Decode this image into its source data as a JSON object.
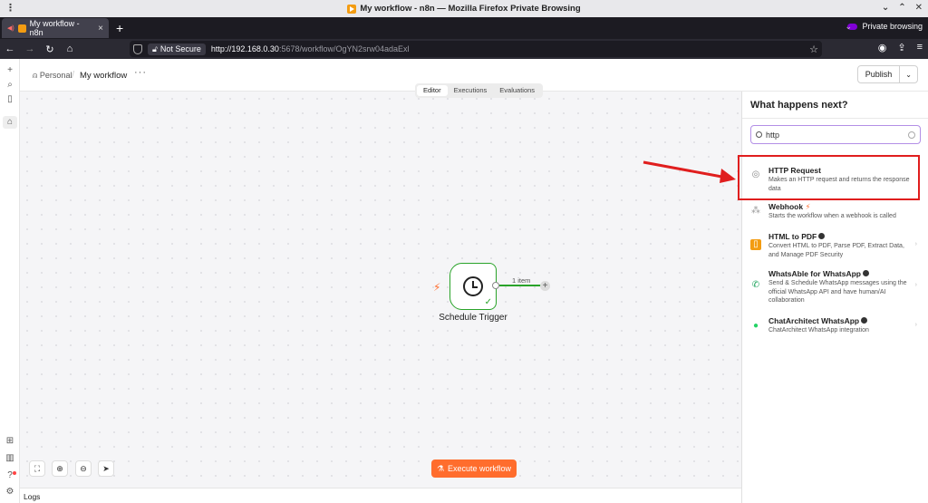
{
  "window": {
    "title": "My workflow - n8n — Mozilla Firefox Private Browsing"
  },
  "tabs": [
    {
      "label": "My workflow - n8n"
    }
  ],
  "private": {
    "label": "Private browsing"
  },
  "url": {
    "security": "Not Secure",
    "host": "http://192.168.0.30",
    "rest": ":5678/workflow/OgYN2srw04adaExl"
  },
  "breadcrumb": {
    "owner": "Personal",
    "workflow": "My workflow"
  },
  "header": {
    "publish": "Publish",
    "tabs": [
      "Editor",
      "Executions",
      "Evaluations"
    ]
  },
  "canvas": {
    "node_title": "Schedule Trigger",
    "edge_label": "1 item",
    "execute_label": "Execute workflow"
  },
  "logs": {
    "label": "Logs"
  },
  "panel": {
    "title": "What happens next?",
    "search_value": "http",
    "results": [
      {
        "name": "HTTP Request",
        "desc": "Makes an HTTP request and returns the response data",
        "icon": "globe-icon"
      },
      {
        "name": "Webhook",
        "desc": "Starts the workflow when a webhook is called",
        "icon": "webhook-icon"
      },
      {
        "name": "HTML to PDF",
        "desc": "Convert HTML to PDF, Parse PDF, Extract Data, and Manage PDF Security",
        "icon": "pdf-icon"
      },
      {
        "name": "WhatsAble for WhatsApp",
        "desc": "Send & Schedule WhatsApp messages using the official WhatsApp API and have human/AI collaboration",
        "icon": "whatsable-icon"
      },
      {
        "name": "ChatArchitect WhatsApp",
        "desc": "ChatArchitect WhatsApp integration",
        "icon": "whatsapp-icon"
      }
    ]
  },
  "colors": {
    "accent": "#ff6d2d",
    "success": "#29a329",
    "highlight": "#e01e1e"
  }
}
